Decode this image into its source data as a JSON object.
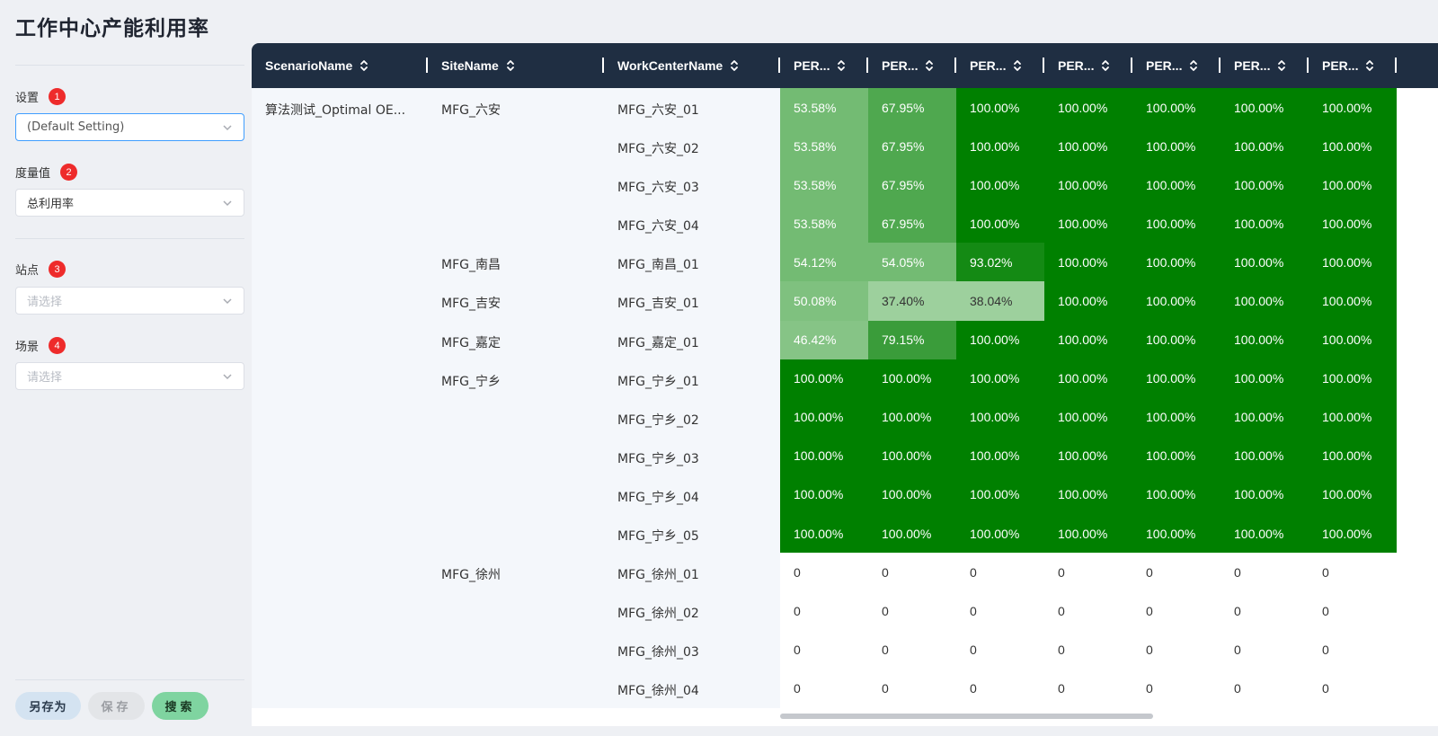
{
  "page": {
    "title": "工作中心产能利用率"
  },
  "filters": {
    "setting": {
      "label": "设置",
      "badge": "1",
      "value": "(Default Setting)"
    },
    "measure": {
      "label": "度量值",
      "badge": "2",
      "value": "总利用率"
    },
    "site": {
      "label": "站点",
      "badge": "3",
      "placeholder": "请选择"
    },
    "scenario": {
      "label": "场景",
      "badge": "4",
      "placeholder": "请选择"
    }
  },
  "buttons": {
    "save_as": "另存为",
    "save": "保存",
    "search": "搜索"
  },
  "table": {
    "columns": [
      "ScenarioName",
      "SiteName",
      "WorkCenterName",
      "PER...",
      "PER...",
      "PER...",
      "PER...",
      "PER...",
      "PER...",
      "PER..."
    ],
    "rows": [
      {
        "scenario": "算法测试_Optimal OE...",
        "site": "MFG_六安",
        "wc": "MFG_六安_01",
        "values": [
          "53.58%",
          "67.95%",
          "100.00%",
          "100.00%",
          "100.00%",
          "100.00%",
          "100.00%"
        ]
      },
      {
        "scenario": "",
        "site": "",
        "wc": "MFG_六安_02",
        "values": [
          "53.58%",
          "67.95%",
          "100.00%",
          "100.00%",
          "100.00%",
          "100.00%",
          "100.00%"
        ]
      },
      {
        "scenario": "",
        "site": "",
        "wc": "MFG_六安_03",
        "values": [
          "53.58%",
          "67.95%",
          "100.00%",
          "100.00%",
          "100.00%",
          "100.00%",
          "100.00%"
        ]
      },
      {
        "scenario": "",
        "site": "",
        "wc": "MFG_六安_04",
        "values": [
          "53.58%",
          "67.95%",
          "100.00%",
          "100.00%",
          "100.00%",
          "100.00%",
          "100.00%"
        ]
      },
      {
        "scenario": "",
        "site": "MFG_南昌",
        "wc": "MFG_南昌_01",
        "values": [
          "54.12%",
          "54.05%",
          "93.02%",
          "100.00%",
          "100.00%",
          "100.00%",
          "100.00%"
        ]
      },
      {
        "scenario": "",
        "site": "MFG_吉安",
        "wc": "MFG_吉安_01",
        "values": [
          "50.08%",
          "37.40%",
          "38.04%",
          "100.00%",
          "100.00%",
          "100.00%",
          "100.00%"
        ]
      },
      {
        "scenario": "",
        "site": "MFG_嘉定",
        "wc": "MFG_嘉定_01",
        "values": [
          "46.42%",
          "79.15%",
          "100.00%",
          "100.00%",
          "100.00%",
          "100.00%",
          "100.00%"
        ]
      },
      {
        "scenario": "",
        "site": "MFG_宁乡",
        "wc": "MFG_宁乡_01",
        "values": [
          "100.00%",
          "100.00%",
          "100.00%",
          "100.00%",
          "100.00%",
          "100.00%",
          "100.00%"
        ]
      },
      {
        "scenario": "",
        "site": "",
        "wc": "MFG_宁乡_02",
        "values": [
          "100.00%",
          "100.00%",
          "100.00%",
          "100.00%",
          "100.00%",
          "100.00%",
          "100.00%"
        ]
      },
      {
        "scenario": "",
        "site": "",
        "wc": "MFG_宁乡_03",
        "values": [
          "100.00%",
          "100.00%",
          "100.00%",
          "100.00%",
          "100.00%",
          "100.00%",
          "100.00%"
        ]
      },
      {
        "scenario": "",
        "site": "",
        "wc": "MFG_宁乡_04",
        "values": [
          "100.00%",
          "100.00%",
          "100.00%",
          "100.00%",
          "100.00%",
          "100.00%",
          "100.00%"
        ]
      },
      {
        "scenario": "",
        "site": "",
        "wc": "MFG_宁乡_05",
        "values": [
          "100.00%",
          "100.00%",
          "100.00%",
          "100.00%",
          "100.00%",
          "100.00%",
          "100.00%"
        ]
      },
      {
        "scenario": "",
        "site": "MFG_徐州",
        "wc": "MFG_徐州_01",
        "values": [
          "0",
          "0",
          "0",
          "0",
          "0",
          "0",
          "0"
        ]
      },
      {
        "scenario": "",
        "site": "",
        "wc": "MFG_徐州_02",
        "values": [
          "0",
          "0",
          "0",
          "0",
          "0",
          "0",
          "0"
        ]
      },
      {
        "scenario": "",
        "site": "",
        "wc": "MFG_徐州_03",
        "values": [
          "0",
          "0",
          "0",
          "0",
          "0",
          "0",
          "0"
        ]
      },
      {
        "scenario": "",
        "site": "",
        "wc": "MFG_徐州_04",
        "values": [
          "0",
          "0",
          "0",
          "0",
          "0",
          "0",
          "0"
        ]
      }
    ]
  },
  "colors": {
    "header_bg": "#1f2e42",
    "heat_100": "#008000",
    "heat_93": "#148a14",
    "heat_79": "#3a9c3a",
    "heat_68": "#4fa84f",
    "heat_54": "#73bb73",
    "heat_50": "#7fc17f",
    "heat_46": "#86c486",
    "heat_38": "#9dd09d",
    "zero_bg": "#ffffff"
  }
}
